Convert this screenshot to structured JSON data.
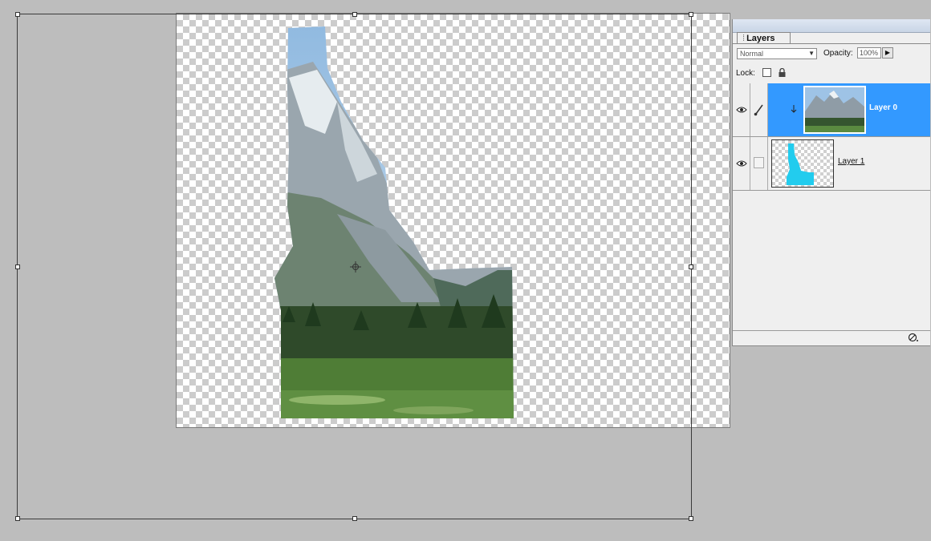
{
  "layers_panel": {
    "tab_label": "Layers",
    "blend_mode": "Normal",
    "opacity_label": "Opacity:",
    "opacity_value": "100%",
    "lock_label": "Lock:",
    "layers": [
      {
        "name": "Layer 0",
        "selected": true,
        "visible": true
      },
      {
        "name": "Layer 1",
        "selected": false,
        "visible": true
      }
    ]
  },
  "colors": {
    "canvas_bg": "#bdbdbd",
    "selection": "#3399ff",
    "shape_cyan": "#22ccee"
  }
}
